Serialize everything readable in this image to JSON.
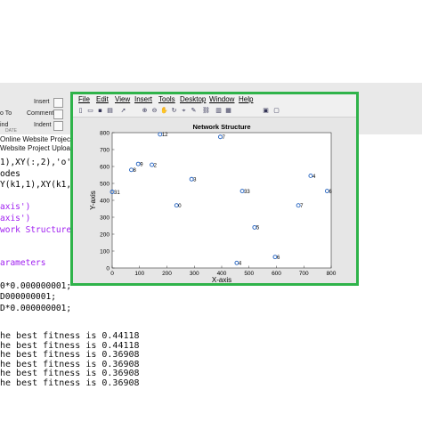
{
  "ribbon": {
    "labels": [
      "Insert",
      "Comment",
      "Indent",
      "o To",
      "ind"
    ],
    "section": "DATE"
  },
  "path": {
    "line1": "Online Website Project Up",
    "line2": "Website Project Upload\\O"
  },
  "editor": {
    "lines": [
      {
        "text": "1),XY(:,2),'o'",
        "color": "#000000"
      },
      {
        "text": "odes",
        "color": "#000000"
      },
      {
        "text": "Y(k1,1),XY(k1,",
        "color": "#000000"
      },
      {
        "text": "",
        "color": "#000000"
      },
      {
        "text": "axis')",
        "color": "#a020f0"
      },
      {
        "text": "axis')",
        "color": "#a020f0"
      },
      {
        "text": "work Structure",
        "color": "#a020f0"
      },
      {
        "text": "",
        "color": "#000000"
      },
      {
        "text": "",
        "color": "#000000"
      },
      {
        "text": "arameters",
        "color": "#a020f0"
      },
      {
        "text": "",
        "color": "#000000"
      },
      {
        "text": "0*0.000000001;",
        "color": "#000000"
      },
      {
        "text": "D000000001;",
        "color": "#000000"
      },
      {
        "text": "D*0.000000001;",
        "color": "#000000"
      }
    ]
  },
  "command_window": {
    "lines": [
      "he best fitness is 0.44118",
      "he best fitness is 0.44118",
      "he best fitness is 0.36908",
      "he best fitness is 0.36908",
      "he best fitness is 0.36908",
      "he best fitness is 0.36908"
    ]
  },
  "figure": {
    "menus": [
      "File",
      "Edit",
      "View",
      "Insert",
      "Tools",
      "Desktop",
      "Window",
      "Help"
    ],
    "toolbar_icons": [
      "new-file-icon",
      "open-folder-icon",
      "save-icon",
      "print-icon",
      "arrow-pointer-icon",
      "zoom-in-icon",
      "zoom-out-icon",
      "pan-hand-icon",
      "rotate-icon",
      "data-cursor-icon",
      "brush-icon",
      "link-icon",
      "colorbar-icon",
      "legend-icon",
      "hide-plot-tools-icon",
      "show-plot-tools-icon"
    ]
  },
  "chart_data": {
    "type": "scatter",
    "title": "Network Structure",
    "xlabel": "X-axis",
    "ylabel": "Y-axis",
    "xlim": [
      0,
      800
    ],
    "ylim": [
      0,
      800
    ],
    "xticks": [
      0,
      100,
      200,
      300,
      400,
      500,
      600,
      700,
      800
    ],
    "yticks": [
      0,
      100,
      200,
      300,
      400,
      500,
      600,
      700,
      800
    ],
    "marker_color": "#1f5fbf",
    "grid": false,
    "points": [
      {
        "x": 175,
        "y": 790,
        "label": "12"
      },
      {
        "x": 395,
        "y": 775,
        "label": "7"
      },
      {
        "x": 95,
        "y": 615,
        "label": "9"
      },
      {
        "x": 145,
        "y": 610,
        "label": "2"
      },
      {
        "x": 70,
        "y": 580,
        "label": "8"
      },
      {
        "x": 725,
        "y": 545,
        "label": "4"
      },
      {
        "x": 290,
        "y": 525,
        "label": "3"
      },
      {
        "x": 785,
        "y": 455,
        "label": "6"
      },
      {
        "x": 0,
        "y": 450,
        "label": "31"
      },
      {
        "x": 475,
        "y": 455,
        "label": "33"
      },
      {
        "x": 235,
        "y": 370,
        "label": "0"
      },
      {
        "x": 680,
        "y": 370,
        "label": "7"
      },
      {
        "x": 520,
        "y": 240,
        "label": "5"
      },
      {
        "x": 595,
        "y": 65,
        "label": "6"
      },
      {
        "x": 455,
        "y": 30,
        "label": "4"
      }
    ]
  }
}
